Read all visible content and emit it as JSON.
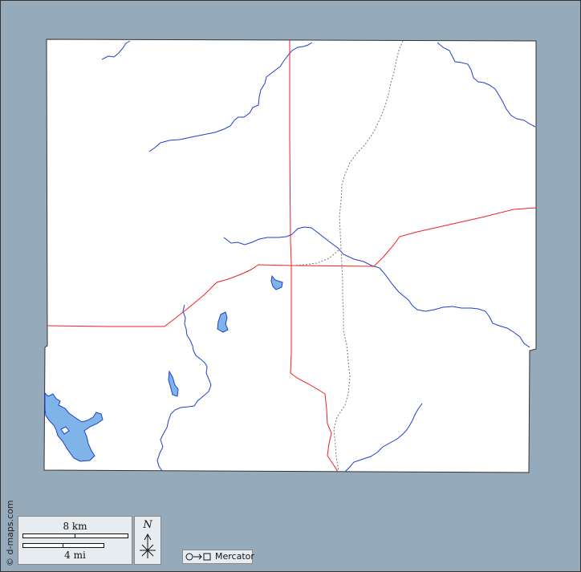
{
  "map": {
    "credit": "© d-maps.com",
    "projection": "Mercator",
    "compass_label": "N",
    "scale": {
      "km_label": "8 km",
      "mi_label": "4 mi"
    },
    "colors": {
      "background": "#95aabb",
      "land": "#ffffff",
      "water": "#7eb4e8",
      "river": "#1f3fcf",
      "road": "#ee2222",
      "rail": "#777777",
      "border": "#333333"
    }
  }
}
